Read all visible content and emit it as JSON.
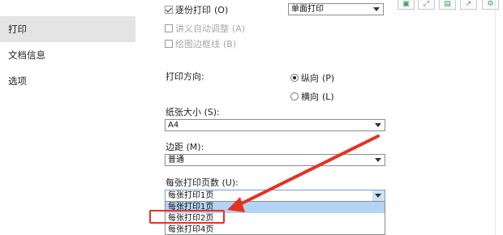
{
  "sidebar": {
    "items": [
      {
        "label": "打印",
        "active": true
      },
      {
        "label": "文档信息",
        "active": false
      },
      {
        "label": "选项",
        "active": false
      }
    ]
  },
  "options": {
    "duplex_label": "逐份打印",
    "duplex_hotkey": "(O)",
    "duplex_checked": true,
    "duplex_select_value": "单面打印",
    "handout_label": "讲义自动调整",
    "handout_hotkey": "(A)",
    "drawing_border_label": "绘图边框线",
    "drawing_border_hotkey": "(B)"
  },
  "orientation": {
    "label": "打印方向:",
    "portrait": "纵向",
    "portrait_hotkey": "(P)",
    "landscape": "横向",
    "landscape_hotkey": "(L)",
    "selected": "portrait"
  },
  "paper_size": {
    "label": "纸张大小 (S):",
    "value": "A4"
  },
  "margins": {
    "label": "边距 (M):",
    "value": "普通"
  },
  "pages_per_sheet": {
    "label": "每张打印页数 (U):",
    "value": "每张打印1页",
    "options": [
      "每张打印1页",
      "每张打印2页",
      "每张打印4页"
    ],
    "highlighted_index": 0,
    "annotated_index": 1
  },
  "toolbar": {
    "icons": [
      "save-icon",
      "expand-icon",
      "export-icon",
      "share-icon",
      "settings-icon"
    ]
  },
  "colors": {
    "annotation": "#e53222",
    "selection": "#b3d4f5",
    "sidebar_active": "#e4e4e4",
    "toolbar_icon": "#3d9a5f"
  }
}
